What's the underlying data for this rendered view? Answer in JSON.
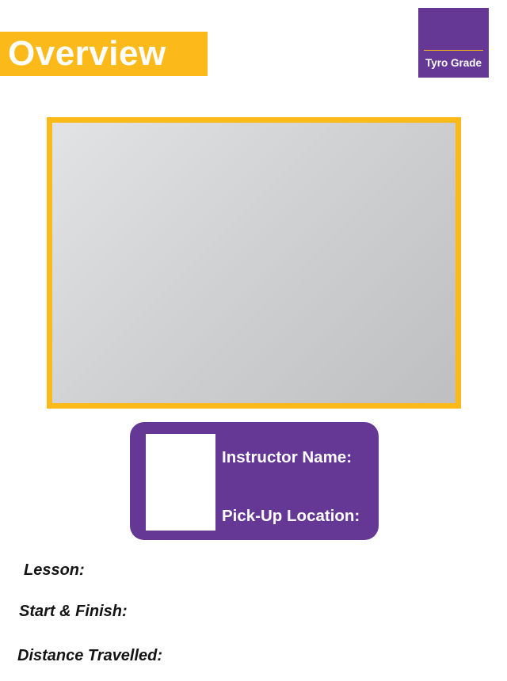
{
  "header": {
    "title": "Overview"
  },
  "grade_badge": {
    "label": "Tyro Grade"
  },
  "instructor_card": {
    "name_label": "Instructor Name:",
    "pickup_label": "Pick-Up Location:"
  },
  "fields": {
    "lesson_label": "Lesson:",
    "start_finish_label": "Start & Finish:",
    "distance_label": "Distance Travelled:"
  },
  "colors": {
    "accent_yellow": "#FBBA19",
    "brand_purple": "#653896",
    "photo_placeholder": "#CFD0D2"
  }
}
